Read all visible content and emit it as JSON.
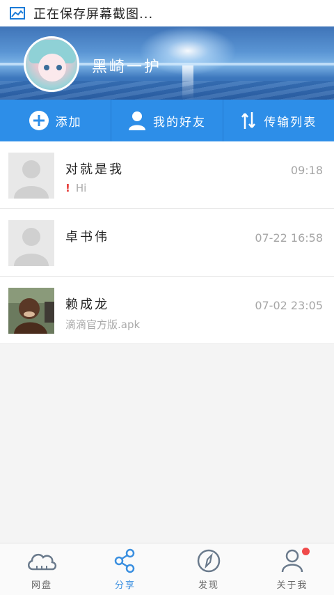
{
  "status_bar": {
    "text": "正在保存屏幕截图...",
    "icon": "screenshot-icon"
  },
  "profile": {
    "username": "黑崎一护"
  },
  "actions": [
    {
      "label": "添加",
      "icon": "plus-circle-icon"
    },
    {
      "label": "我的好友",
      "icon": "person-icon"
    },
    {
      "label": "传输列表",
      "icon": "transfer-arrows-icon"
    }
  ],
  "conversations": [
    {
      "name": "对就是我",
      "sub": "Hi",
      "sub_alert": "!",
      "time": "09:18"
    },
    {
      "name": "卓书伟",
      "sub": "",
      "time": "07-22 16:58"
    },
    {
      "name": "赖成龙",
      "sub": "滴滴官方版.apk",
      "time": "07-02 23:05"
    }
  ],
  "tabs": [
    {
      "label": "网盘",
      "icon": "cloud-icon"
    },
    {
      "label": "分享",
      "icon": "share-icon"
    },
    {
      "label": "发现",
      "icon": "compass-icon"
    },
    {
      "label": "关于我",
      "icon": "person-outline-icon"
    }
  ],
  "colors": {
    "accent": "#2d8ee8",
    "alert": "#e53935",
    "badge": "#f04a4a"
  }
}
